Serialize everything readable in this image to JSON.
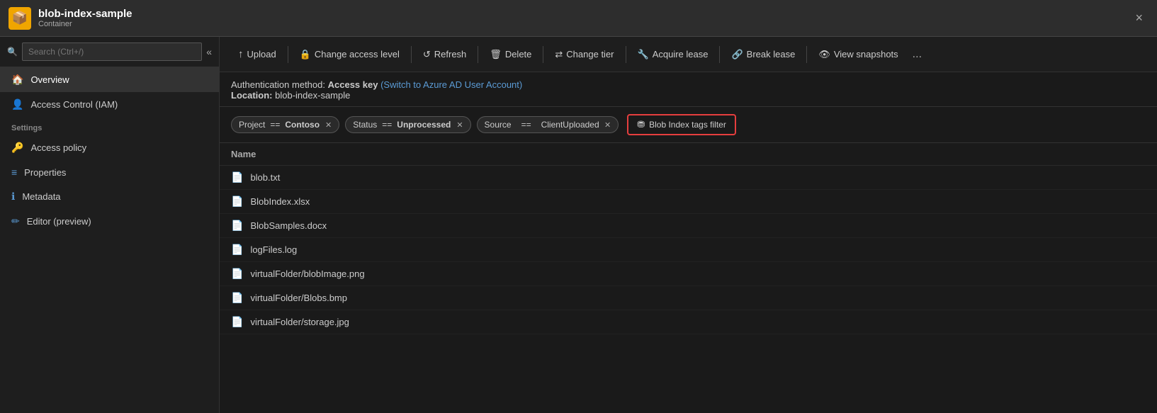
{
  "titlebar": {
    "icon": "📦",
    "title": "blob-index-sample",
    "subtitle": "Container",
    "close": "×"
  },
  "sidebar": {
    "search_placeholder": "Search (Ctrl+/)",
    "items": [
      {
        "id": "overview",
        "label": "Overview",
        "icon": "🏠",
        "active": true
      },
      {
        "id": "iam",
        "label": "Access Control (IAM)",
        "icon": "👤",
        "active": false
      }
    ],
    "settings_label": "Settings",
    "settings_items": [
      {
        "id": "access-policy",
        "label": "Access policy",
        "icon": "🔑"
      },
      {
        "id": "properties",
        "label": "Properties",
        "icon": "≡"
      },
      {
        "id": "metadata",
        "label": "Metadata",
        "icon": "ℹ"
      },
      {
        "id": "editor",
        "label": "Editor (preview)",
        "icon": "✏"
      }
    ]
  },
  "toolbar": {
    "buttons": [
      {
        "id": "upload",
        "icon": "↑",
        "label": "Upload"
      },
      {
        "id": "change-access",
        "icon": "🔒",
        "label": "Change access level"
      },
      {
        "id": "refresh",
        "icon": "↺",
        "label": "Refresh"
      },
      {
        "id": "delete",
        "icon": "🗑",
        "label": "Delete"
      },
      {
        "id": "change-tier",
        "icon": "⇄",
        "label": "Change tier"
      },
      {
        "id": "acquire-lease",
        "icon": "🔧",
        "label": "Acquire lease"
      },
      {
        "id": "break-lease",
        "icon": "🔗",
        "label": "Break lease"
      },
      {
        "id": "view-snapshots",
        "icon": "👁",
        "label": "View snapshots"
      }
    ],
    "more": "..."
  },
  "auth": {
    "prefix": "Authentication method:",
    "method": "Access key",
    "switch_link": "(Switch to Azure AD User Account)",
    "location_prefix": "Location:",
    "location": "blob-index-sample"
  },
  "filters": {
    "project_key": "Project",
    "project_eq": "==",
    "project_val": "Contoso",
    "status_key": "Status",
    "status_eq": "==",
    "status_val": "Unprocessed",
    "source_key": "Source",
    "source_eq": "==",
    "source_val": "ClientUploaded",
    "index_btn": "Blob Index tags filter"
  },
  "file_list": {
    "name_header": "Name",
    "files": [
      {
        "name": "blob.txt"
      },
      {
        "name": "BlobIndex.xlsx"
      },
      {
        "name": "BlobSamples.docx"
      },
      {
        "name": "logFiles.log"
      },
      {
        "name": "virtualFolder/blobImage.png"
      },
      {
        "name": "virtualFolder/Blobs.bmp"
      },
      {
        "name": "virtualFolder/storage.jpg"
      }
    ]
  }
}
